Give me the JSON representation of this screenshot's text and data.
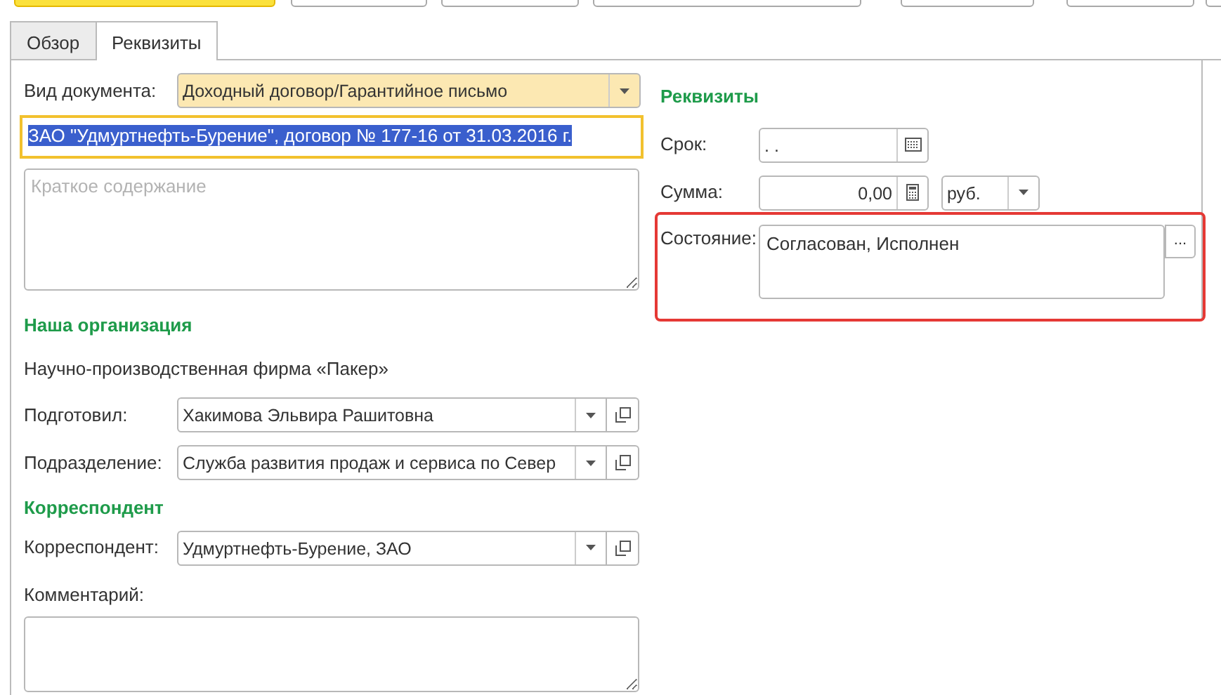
{
  "toolbar": {
    "buttons": [
      {
        "default": true
      },
      {
        "default": false
      },
      {
        "default": false
      },
      {
        "default": false
      },
      {
        "default": false
      },
      {
        "default": false
      },
      {
        "default": false
      }
    ]
  },
  "tabs": [
    {
      "label": "Обзор",
      "selected": false
    },
    {
      "label": "Реквизиты",
      "selected": true
    }
  ],
  "left": {
    "doc_type": {
      "label": "Вид документа:",
      "value": "Доходный договор/Гарантийное письмо"
    },
    "title_field": {
      "value": "ЗАО \"Удмуртнефть-Бурение\", договор № 177-16 от 31.03.2016 г.",
      "selected": true
    },
    "summary": {
      "placeholder": "Краткое содержание"
    },
    "our_org": {
      "heading": "Наша организация",
      "name": "Научно-производственная фирма «Пакер»",
      "fields": [
        {
          "label": "Подготовил:",
          "value": "Хакимова Эльвира Рашитовна"
        },
        {
          "label": "Подразделение:",
          "value": "Служба развития продаж и сервиса по Север"
        }
      ]
    },
    "correspondent": {
      "heading": "Корреспондент",
      "fields": [
        {
          "label": "Корреспондент:",
          "value": "Удмуртнефть-Бурение, ЗАО"
        }
      ]
    },
    "comment": {
      "label": "Комментарий:"
    }
  },
  "right": {
    "heading": "Реквизиты",
    "term": {
      "label": "Срок:",
      "value": " .  ."
    },
    "sum": {
      "label": "Сумма:",
      "value": "0,00",
      "currency": "руб."
    },
    "state": {
      "label": "Состояние:",
      "value": "Согласован, Исполнен",
      "highlighted": true,
      "button": "..."
    }
  }
}
